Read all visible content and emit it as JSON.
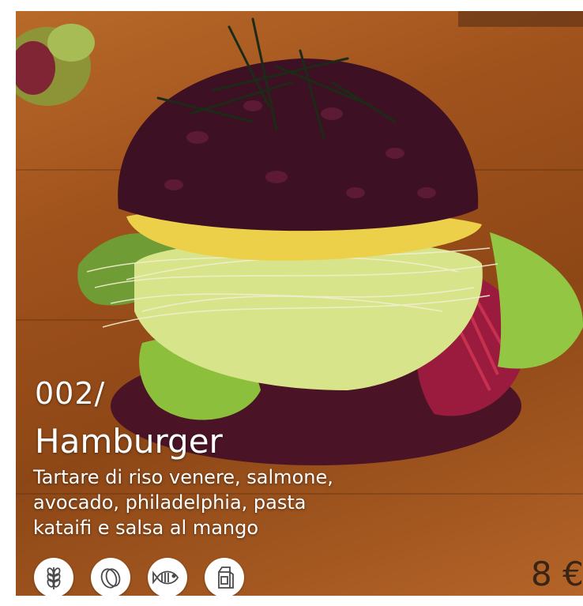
{
  "item": {
    "code": "002/",
    "title": "Hamburger",
    "description_lines": [
      "Tartare di riso venere, salmone,",
      "avocado, philadelphia, pasta",
      "kataifi e salsa al mango"
    ],
    "price": "8 €"
  },
  "allergens": [
    {
      "name": "gluten",
      "icon": "wheat-icon"
    },
    {
      "name": "eggs",
      "icon": "egg-icon"
    },
    {
      "name": "fish",
      "icon": "fish-icon"
    },
    {
      "name": "milk",
      "icon": "milk-carton-icon"
    }
  ],
  "colors": {
    "text": "#ffffff",
    "price": "#3a2414",
    "icon_bg": "#ffffff",
    "icon_stroke": "#4a4a4a"
  }
}
